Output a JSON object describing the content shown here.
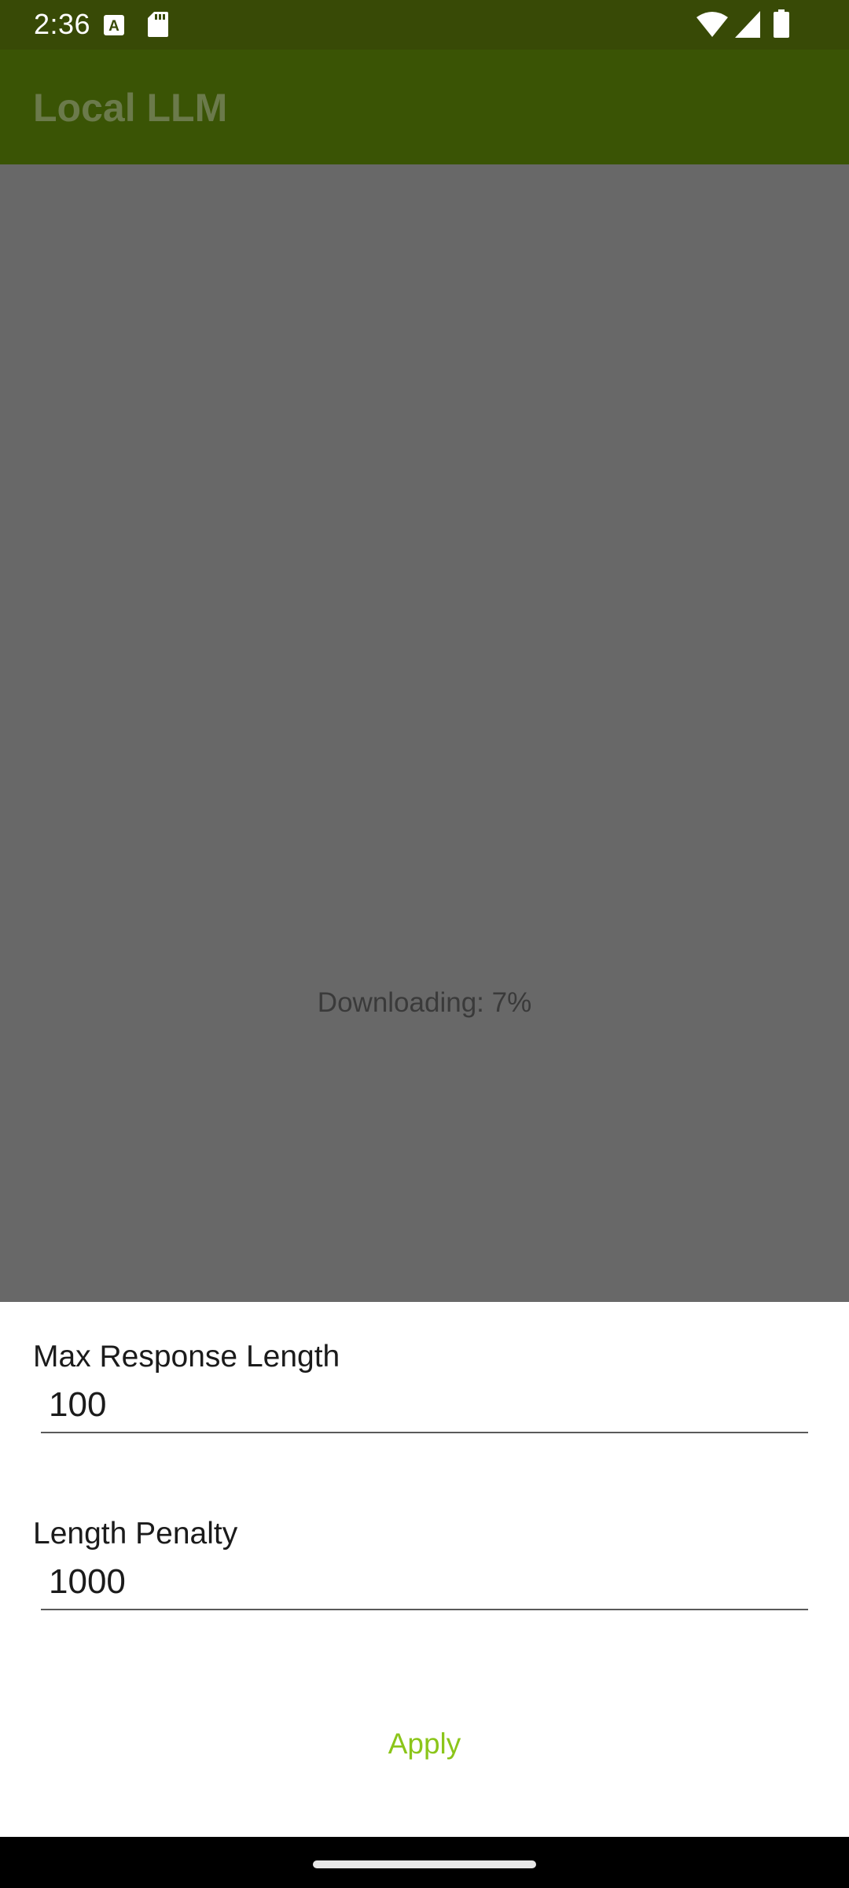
{
  "status_bar": {
    "time": "2:36",
    "notification_icons": [
      "keyboard-a-icon",
      "sd-card-icon"
    ],
    "system_icons": [
      "wifi-icon",
      "cell-signal-icon",
      "battery-icon"
    ]
  },
  "app_bar": {
    "title": "Local LLM",
    "color": "#3a5405"
  },
  "content": {
    "download_status": "Downloading: 7%",
    "download_progress_percent": 7
  },
  "settings_sheet": {
    "max_response_length": {
      "label": "Max Response Length",
      "value": "100"
    },
    "length_penalty": {
      "label": "Length Penalty",
      "value": "1000"
    },
    "apply_label": "Apply",
    "accent_color": "#8bc51a"
  }
}
